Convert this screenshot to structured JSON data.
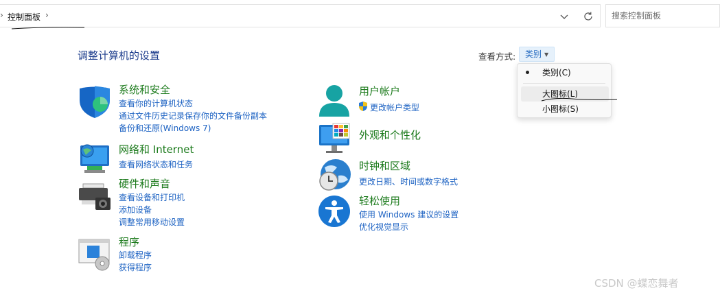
{
  "address_bar": {
    "breadcrumb": "控制面板",
    "left_arrow": "›",
    "separator": "›"
  },
  "search": {
    "placeholder": "搜索控制面板"
  },
  "header": {
    "title": "调整计算机的设置",
    "view_by_label": "查看方式:",
    "view_by_value": "类别"
  },
  "view_menu": {
    "items": [
      {
        "label": "类别(C)",
        "selected": true
      },
      {
        "label": "大图标(L)",
        "selected": false
      },
      {
        "label": "小图标(S)",
        "selected": false
      }
    ]
  },
  "categories": {
    "system": {
      "title": "系统和安全",
      "links": [
        "查看你的计算机状态",
        "通过文件历史记录保存你的文件备份副本",
        "备份和还原(Windows 7)"
      ]
    },
    "network": {
      "title": "网络和 Internet",
      "links": [
        "查看网络状态和任务"
      ]
    },
    "hardware": {
      "title": "硬件和声音",
      "links": [
        "查看设备和打印机",
        "添加设备",
        "调整常用移动设置"
      ]
    },
    "programs": {
      "title": "程序",
      "links": [
        "卸载程序",
        "获得程序"
      ]
    },
    "accounts": {
      "title": "用户帐户",
      "links": [
        "更改帐户类型"
      ]
    },
    "appearance": {
      "title": "外观和个性化",
      "links": []
    },
    "clock": {
      "title": "时钟和区域",
      "links": [
        "更改日期、时间或数字格式"
      ]
    },
    "ease": {
      "title": "轻松使用",
      "links": [
        "使用 Windows 建议的设置",
        "优化视觉显示"
      ]
    }
  },
  "watermark": "CSDN @蝶恋舞者",
  "colors": {
    "title_blue": "#1c3c8c",
    "category_green": "#1b7a1b",
    "link_blue": "#1e63c3",
    "accent": "#2a6ec2"
  }
}
